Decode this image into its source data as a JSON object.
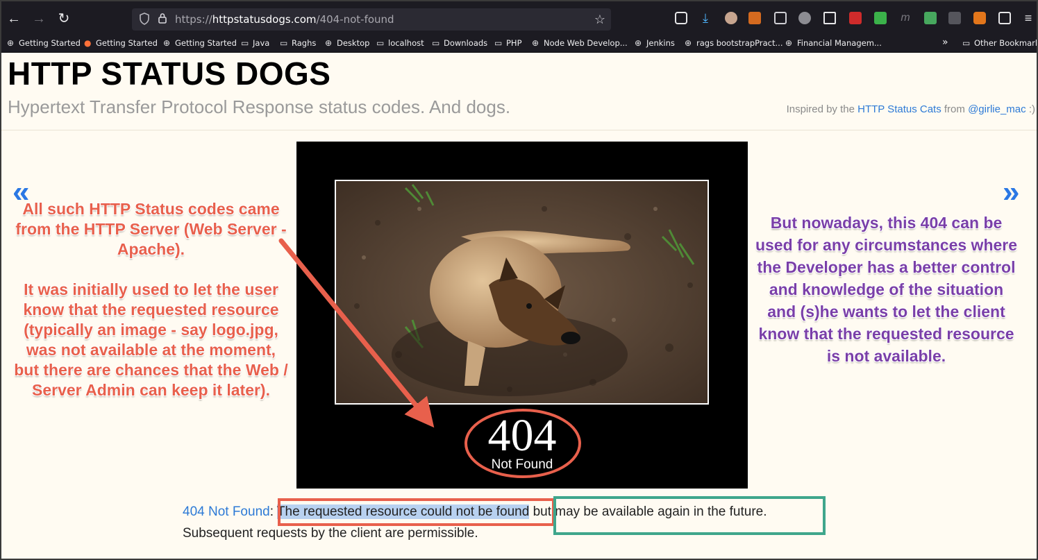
{
  "browser": {
    "url_prefix": "https://",
    "url_host": "httpstatusdogs.com",
    "url_path": "/404-not-found",
    "nav": {
      "back": "←",
      "forward": "→",
      "reload": "↻"
    },
    "bookmarks": [
      {
        "label": "Getting Started",
        "icon": "globe-icon"
      },
      {
        "label": "Getting Started",
        "icon": "firefox-icon"
      },
      {
        "label": "Getting Started",
        "icon": "globe-icon"
      },
      {
        "label": "Java",
        "icon": "folder-icon"
      },
      {
        "label": "Raghs",
        "icon": "folder-icon"
      },
      {
        "label": "Desktop",
        "icon": "globe-icon"
      },
      {
        "label": "localhost",
        "icon": "folder-icon"
      },
      {
        "label": "Downloads",
        "icon": "folder-icon"
      },
      {
        "label": "PHP",
        "icon": "folder-icon"
      },
      {
        "label": "Node Web Develop...",
        "icon": "globe-icon"
      },
      {
        "label": "Jenkins",
        "icon": "globe-icon"
      },
      {
        "label": "rags bootstrapPract...",
        "icon": "globe-icon"
      },
      {
        "label": "Financial Managem...",
        "icon": "globe-icon"
      }
    ],
    "overflow": "»",
    "other_bookmarks": "Other Bookmarks"
  },
  "site": {
    "title": "HTTP STATUS DOGS",
    "subtitle": "Hypertext Transfer Protocol Response status codes. And dogs.",
    "inspired_prefix": "Inspired by the ",
    "inspired_link": "HTTP Status Cats",
    "inspired_mid": " from ",
    "inspired_author": "@girlie_mac",
    "inspired_suffix": " :)"
  },
  "pager": {
    "prev": "«",
    "next": "»"
  },
  "poster": {
    "code": "404",
    "label": "Not Found"
  },
  "description": {
    "link": "404 Not Found",
    "colon": ": ",
    "highlight": "The requested resource could not be found",
    "rest": "but may be available again in the future.",
    "line2": "Subsequent requests by the client are permissible."
  },
  "annotations": {
    "left_p1": "All such HTTP Status codes came from the HTTP Server (Web Server - Apache).",
    "left_p2": "It was initially used to let the user know that the requested resource (typically an image - say logo.jpg, was not available at the moment, but there are chances that the Web / Server Admin can keep it later).",
    "right": "But nowadays, this 404 can be used for any circumstances where the Developer has a better control and knowledge of the situation and (s)he wants to let the client know that the requested resource is not available."
  },
  "colors": {
    "link": "#2d7ad6",
    "annotation_red": "#e8604c",
    "annotation_purple": "#7a3fa8",
    "box_green": "#3fa68c",
    "highlight": "#b8d1f0"
  }
}
